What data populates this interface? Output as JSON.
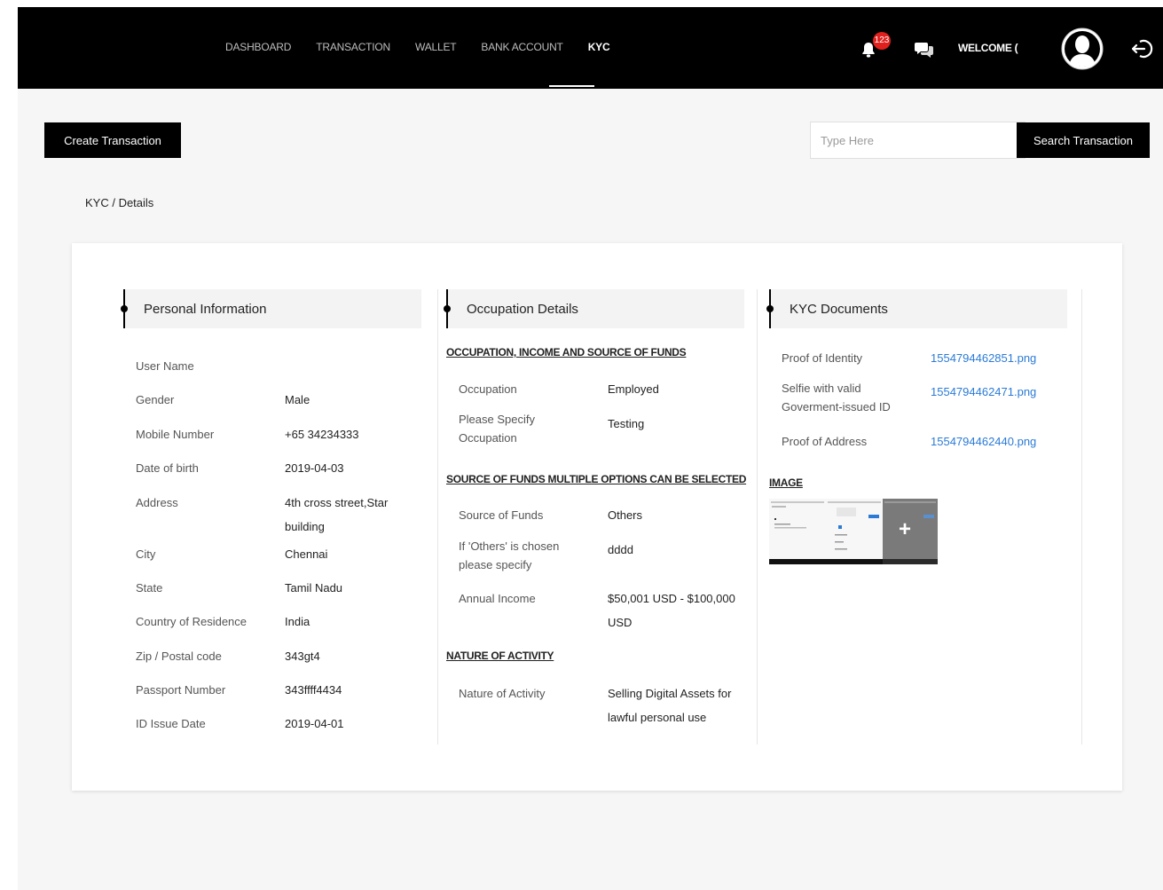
{
  "nav": {
    "items": [
      "DASHBOARD",
      "TRANSACTION",
      "WALLET",
      "BANK ACCOUNT",
      "KYC"
    ],
    "active": "KYC",
    "notification_count": "123",
    "welcome": "WELCOME ("
  },
  "toolbar": {
    "create_label": "Create Transaction",
    "search_placeholder": "Type Here",
    "search_label": "Search Transaction"
  },
  "breadcrumb": "KYC / Details",
  "personal": {
    "title": "Personal Information",
    "rows": [
      {
        "label": "User Name",
        "value": ""
      },
      {
        "label": "Gender",
        "value": "Male"
      },
      {
        "label": "Mobile Number",
        "value": "+65 34234333"
      },
      {
        "label": "Date of birth",
        "value": "2019-04-03"
      },
      {
        "label": "Address",
        "value": "4th cross street,Star building"
      },
      {
        "label": "City",
        "value": "Chennai"
      },
      {
        "label": "State",
        "value": "Tamil Nadu"
      },
      {
        "label": "Country of Residence",
        "value": "India"
      },
      {
        "label": "Zip / Postal code",
        "value": "343gt4"
      },
      {
        "label": "Passport Number",
        "value": "343ffff4434"
      },
      {
        "label": "ID Issue Date",
        "value": "2019-04-01"
      }
    ]
  },
  "occupation": {
    "title": "Occupation Details",
    "section1": "OCCUPATION, INCOME AND SOURCE OF FUNDS",
    "occupation_label": "Occupation",
    "occupation_value": "Employed",
    "specify_label": "Please Specify Occupation",
    "specify_value": "Testing",
    "section2": "SOURCE OF FUNDS MULTIPLE OPTIONS CAN BE SELECTED",
    "source_label": "Source of Funds",
    "source_value": "Others",
    "others_label": "If 'Others' is chosen please specify",
    "others_value": "dddd",
    "income_label": "Annual Income",
    "income_value": "$50,001 USD - $100,000 USD",
    "section3": "NATURE OF ACTIVITY",
    "activity_label": "Nature of Activity",
    "activity_value": "Selling Digital Assets for lawful personal use"
  },
  "kyc_docs": {
    "title": "KYC Documents",
    "identity_label": "Proof of Identity",
    "identity_file": "1554794462851.png",
    "selfie_label": "Selfie with valid Goverment-issued ID",
    "selfie_file": "1554794462471.png",
    "address_label": "Proof of Address",
    "address_file": "1554794462440.png",
    "image_heading": "IMAGE"
  }
}
